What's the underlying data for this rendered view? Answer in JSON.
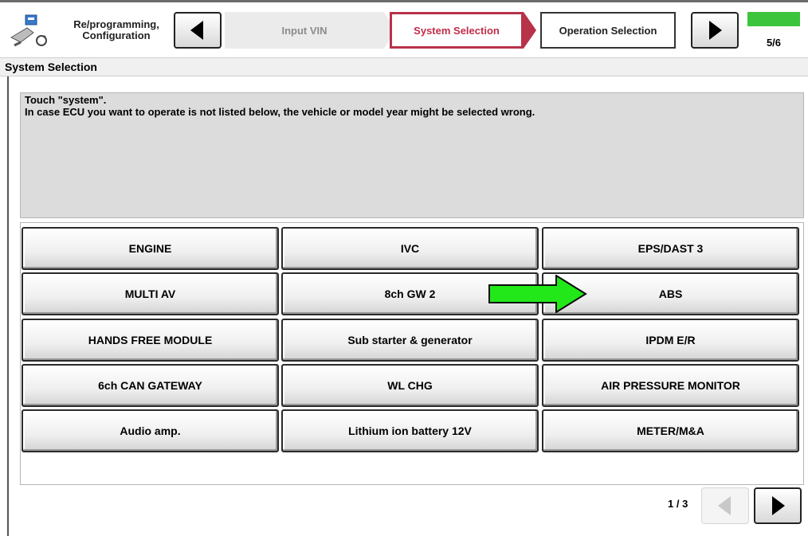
{
  "toolbar": {
    "app_title_line1": "Re/programming,",
    "app_title_line2": "Configuration",
    "steps": [
      {
        "label": "Input VIN",
        "state": "done"
      },
      {
        "label": "System Selection",
        "state": "current"
      },
      {
        "label": "Operation Selection",
        "state": "upcoming"
      }
    ],
    "progress_text": "5/6",
    "icons": {
      "app": "reprogramming-icon",
      "back": "back-arrow-icon",
      "next": "next-arrow-icon"
    }
  },
  "section_title": "System Selection",
  "instructions": {
    "line1": "Touch \"system\".",
    "line2": "In case ECU you want to operate is not listed below, the vehicle or model year might be selected wrong."
  },
  "systems": [
    "ENGINE",
    "IVC",
    "EPS/DAST 3",
    "MULTI AV",
    "8ch GW 2",
    "ABS",
    "HANDS FREE MODULE",
    "Sub starter & generator",
    "IPDM E/R",
    "6ch CAN GATEWAY",
    "WL CHG",
    "AIR PRESSURE MONITOR",
    "Audio amp.",
    "Lithium ion battery 12V",
    "METER/M&A"
  ],
  "pager": {
    "indicator": "1 / 3"
  },
  "colors": {
    "current_step": "#c22d4a",
    "progress": "#3cc43c",
    "pointer": "#22e81a"
  }
}
